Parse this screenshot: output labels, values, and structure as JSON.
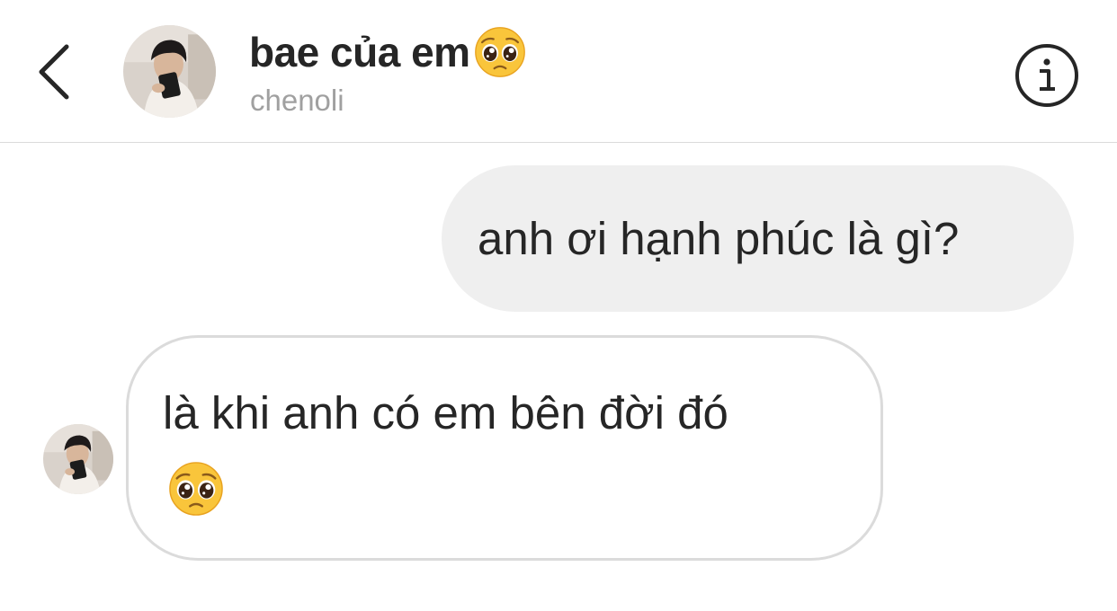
{
  "header": {
    "back_icon": "chevron-left-icon",
    "contact_name": "bae của em",
    "name_emoji": "pleading-face-emoji",
    "username": "chenoli",
    "info_icon": "info-circle-icon"
  },
  "messages": [
    {
      "direction": "outgoing",
      "text": "anh ơi hạnh phúc là gì?"
    },
    {
      "direction": "incoming",
      "text": "là khi anh có em bên đời đó",
      "emoji": "pleading-face-emoji"
    }
  ],
  "colors": {
    "text": "#262626",
    "secondary_text": "#a0a0a0",
    "outgoing_bubble": "#efefef",
    "incoming_border": "#dbdbdb",
    "divider": "#dbdbdb"
  }
}
